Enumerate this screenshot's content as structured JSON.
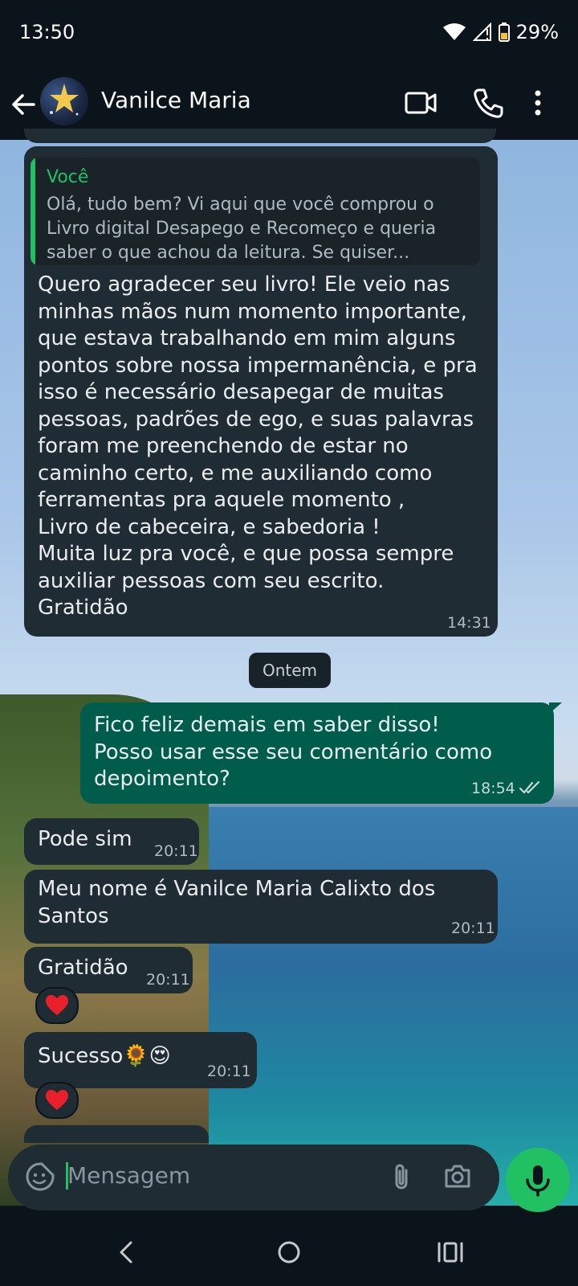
{
  "status_bar": {
    "time": "13:50",
    "battery": "29%"
  },
  "header": {
    "contact_name": "Vanilce Maria"
  },
  "messages": [
    {
      "quoted_author": "Você",
      "quoted_text": "Olá, tudo bem? Vi aqui que você comprou o Livro digital Desapego e Recomeço e queria saber o que achou da leitura. Se quiser...",
      "text": "Quero agradecer seu livro! Ele veio nas minhas mãos num momento importante, que estava trabalhando em mim alguns pontos sobre nossa impermanência, e pra isso é necessário desapegar de muitas pessoas, padrões de ego, e suas palavras foram me preenchendo de estar no caminho certo, e me auxiliando como ferramentas pra aquele momento ,\nLivro de cabeceira, e sabedoria !\nMuita luz pra você, e que possa sempre auxiliar pessoas com seu escrito.\nGratidão",
      "time": "14:31"
    },
    {
      "text": "Fico feliz demais em saber disso!\nPosso usar esse seu comentário como depoimento?",
      "time": "18:54"
    },
    {
      "text": "Pode sim",
      "time": "20:11"
    },
    {
      "text": "Meu nome é Vanilce Maria Calixto dos Santos",
      "time": "20:11"
    },
    {
      "text": "Gratidão",
      "time": "20:11",
      "reaction": "❤️"
    },
    {
      "text": "Sucesso🌻😍",
      "time": "20:11",
      "reaction": "❤️"
    }
  ],
  "date_divider": "Ontem",
  "composer": {
    "placeholder": "Mensagem"
  },
  "colors": {
    "background": "#0b141a",
    "incoming_bubble": "#202c33",
    "outgoing_bubble": "#005c4b",
    "accent": "#21c063"
  },
  "icons": {
    "back": "arrow-left-icon",
    "video": "video-call-icon",
    "call": "phone-icon",
    "menu": "more-vert-icon",
    "sticker": "sticker-icon",
    "attach": "paperclip-icon",
    "camera": "camera-icon",
    "mic": "mic-icon",
    "read": "double-check-icon"
  }
}
